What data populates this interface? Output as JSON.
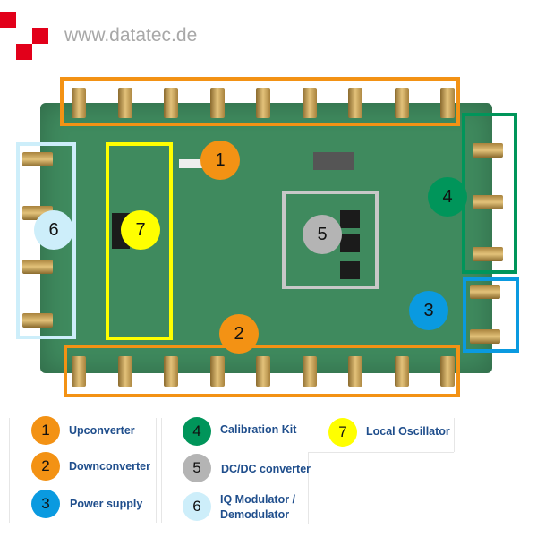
{
  "header": {
    "url_text": "www.datatec.de",
    "logo_color": "#e2001a"
  },
  "callouts": [
    {
      "number": "1",
      "color": "#f39214"
    },
    {
      "number": "2",
      "color": "#f39214"
    },
    {
      "number": "3",
      "color": "#0a9ae0"
    },
    {
      "number": "4",
      "color": "#00955a"
    },
    {
      "number": "5",
      "color": "#b4b4b4"
    },
    {
      "number": "6",
      "color": "#cdeefa"
    },
    {
      "number": "7",
      "color": "#ffff00"
    }
  ],
  "legend": [
    {
      "number": "1",
      "label": "Upconverter"
    },
    {
      "number": "2",
      "label": "Downconverter"
    },
    {
      "number": "3",
      "label": "Power supply"
    },
    {
      "number": "4",
      "label": "Calibration Kit"
    },
    {
      "number": "5",
      "label": "DC/DC converter"
    },
    {
      "number": "6",
      "label": "IQ Modulator / Demodulator"
    },
    {
      "number": "7",
      "label": "Local Oscillator"
    }
  ]
}
